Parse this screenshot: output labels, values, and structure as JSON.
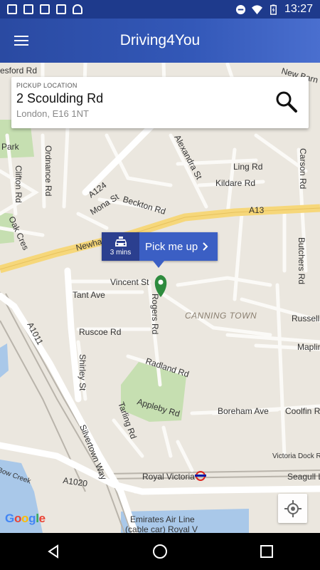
{
  "status_bar": {
    "time": "13:27",
    "left_icons": [
      "image-icon",
      "image-icon",
      "download-icon",
      "briefcase-icon",
      "android-icon"
    ],
    "right_icons": [
      "dnd-icon",
      "wifi-icon",
      "battery-icon"
    ]
  },
  "app_bar": {
    "title": "Driving4You",
    "menu_icon": "hamburger-menu-icon"
  },
  "pickup": {
    "label": "PICKUP LOCATION",
    "street": "2 Scoulding Rd",
    "city": "London, E16 1NT",
    "search_icon": "search-icon"
  },
  "bubble": {
    "eta": "3 mins",
    "action": "Pick me up",
    "taxi_icon": "taxi-icon",
    "chevron_icon": "chevron-right-icon"
  },
  "map": {
    "labels": {
      "sfordRd": "esford Rd",
      "newBarn": "New Barn St",
      "ordnance": "Ordnance Rd",
      "clifton": "Clifton Rd",
      "park": "Park",
      "alexandra": "Alexandra St",
      "ling": "Ling Rd",
      "kildare": "Kildare Rd",
      "carson": "Carson Rd",
      "a124": "A124",
      "mona": "Mona St",
      "beckton": "Beckton Rd",
      "a13": "A13",
      "oakCres": "Oak Cres",
      "newham": "Newham",
      "butchers": "Butchers Rd",
      "vincent": "Vincent St",
      "tant": "Tant Ave",
      "rogers": "Rogers Rd",
      "canning": "CANNING TOWN",
      "russell": "Russell",
      "ruscoe": "Ruscoe Rd",
      "a1011": "A1011",
      "maplin": "Maplin",
      "radland": "Radland Rd",
      "shirley": "Shirley St",
      "tarling": "Tarling Rd",
      "appleby": "Appleby Rd",
      "boreham": "Boreham Ave",
      "coolfin": "Coolfin R",
      "silvertown": "Silvertown Way",
      "victoriaDock": "Victoria Dock Rd",
      "royalVictoria": "Royal Victoria",
      "seagull": "Seagull L",
      "bowCreek": "Bow Creek",
      "a1020": "A1020",
      "emirates1": "Emirates Air Line",
      "emirates2": "(cable car) Royal V"
    },
    "google": [
      "G",
      "o",
      "o",
      "g",
      "l",
      "e"
    ],
    "locate_icon": "my-location-icon"
  },
  "nav": {
    "back_icon": "back-icon",
    "home_icon": "home-icon",
    "recents_icon": "recents-icon"
  },
  "colors": {
    "app_bar": "#2a4aa2",
    "accent": "#3b5fc4",
    "eta_bg": "#2b3f8f",
    "pin": "#2e8b3e",
    "main_road": "#f6d77a"
  }
}
